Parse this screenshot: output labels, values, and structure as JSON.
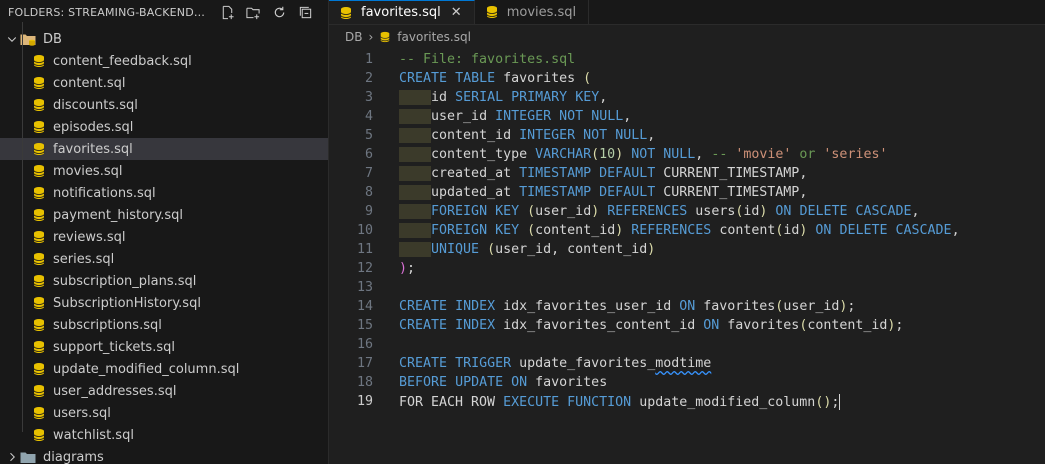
{
  "sidebar": {
    "title": "FOLDERS: STREAMING-BACKEND-APP...",
    "actions": [
      "new-file-icon",
      "new-folder-icon",
      "refresh-icon",
      "collapse-all-icon"
    ],
    "root_folder": "DB",
    "files": [
      "content_feedback.sql",
      "content.sql",
      "discounts.sql",
      "episodes.sql",
      "favorites.sql",
      "movies.sql",
      "notifications.sql",
      "payment_history.sql",
      "reviews.sql",
      "series.sql",
      "subscription_plans.sql",
      "SubscriptionHistory.sql",
      "subscriptions.sql",
      "support_tickets.sql",
      "update_modified_column.sql",
      "user_addresses.sql",
      "users.sql",
      "watchlist.sql"
    ],
    "selected_file": "favorites.sql",
    "collapsed_folder": "diagrams"
  },
  "tabs": [
    {
      "label": "favorites.sql",
      "active": true
    },
    {
      "label": "movies.sql",
      "active": false
    }
  ],
  "breadcrumb": {
    "folder": "DB",
    "file": "favorites.sql"
  },
  "colors": {
    "accent": "#0078d4",
    "db_icon": "#e8c100"
  },
  "code_lines": [
    "-- File: favorites.sql",
    "CREATE TABLE favorites (",
    "    id SERIAL PRIMARY KEY,",
    "    user_id INTEGER NOT NULL,",
    "    content_id INTEGER NOT NULL,",
    "    content_type VARCHAR(10) NOT NULL, -- 'movie' or 'series'",
    "    created_at TIMESTAMP DEFAULT CURRENT_TIMESTAMP,",
    "    updated_at TIMESTAMP DEFAULT CURRENT_TIMESTAMP,",
    "    FOREIGN KEY (user_id) REFERENCES users(id) ON DELETE CASCADE,",
    "    FOREIGN KEY (content_id) REFERENCES content(id) ON DELETE CASCADE,",
    "    UNIQUE (user_id, content_id)",
    ");",
    "",
    "CREATE INDEX idx_favorites_user_id ON favorites(user_id);",
    "CREATE INDEX idx_favorites_content_id ON favorites(content_id);",
    "",
    "CREATE TRIGGER update_favorites_modtime",
    "BEFORE UPDATE ON favorites",
    "FOR EACH ROW EXECUTE FUNCTION update_modified_column();"
  ],
  "current_line": 19
}
